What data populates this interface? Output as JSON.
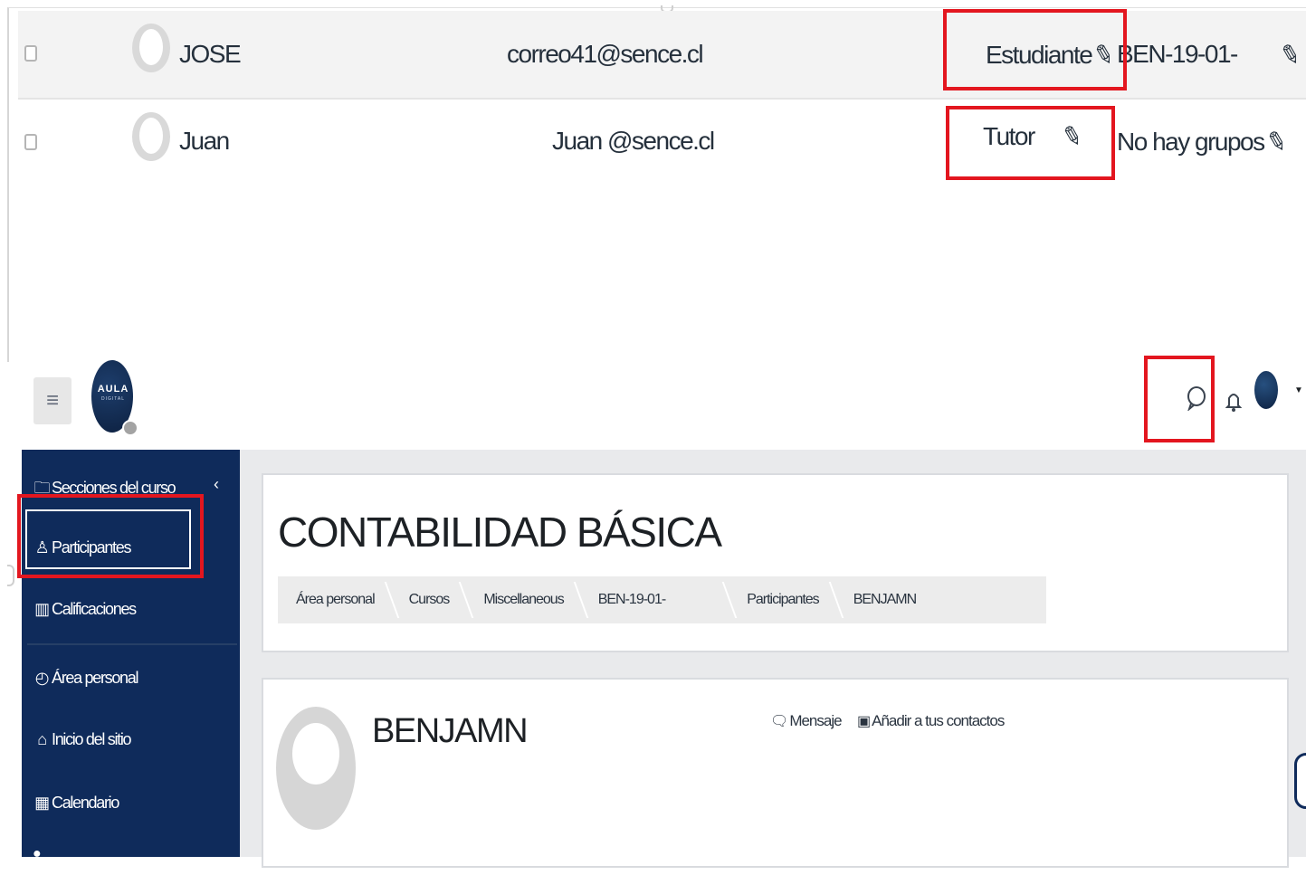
{
  "participants": [
    {
      "name": "JOSE",
      "email": "correo41@sence.cl",
      "role": "Estudiante",
      "group": "BEN-19-01-"
    },
    {
      "name": "Juan",
      "email": "Juan @sence.cl",
      "role": "Tutor",
      "group": "No hay grupos"
    }
  ],
  "header": {
    "logo_text": "AULA",
    "logo_subtext": "DIGITAL",
    "hamburger_glyph": "≡",
    "message_icon": "message-icon",
    "notification_icon": "bell-icon"
  },
  "sidebar": {
    "collapse_glyph": "‹",
    "items": [
      {
        "label": "Secciones del curso",
        "icon": "folder-icon"
      },
      {
        "label": "Participantes",
        "icon": "users-icon"
      },
      {
        "label": "Calificaciones",
        "icon": "grades-icon"
      },
      {
        "label": "Área personal",
        "icon": "dashboard-icon"
      },
      {
        "label": "Inicio del sitio",
        "icon": "home-icon"
      },
      {
        "label": "Calendario",
        "icon": "calendar-icon"
      }
    ]
  },
  "course": {
    "title": "CONTABILIDAD BÁSICA",
    "breadcrumb": [
      "Área personal",
      "Cursos",
      "Miscellaneous",
      "BEN-19-01-",
      "Participantes",
      "BENJAMN"
    ]
  },
  "profile": {
    "name": "BENJAMN",
    "message_label": "Mensaje",
    "add_contact_label": "Añadir a tus contactos"
  },
  "colors": {
    "highlight_red": "#e3161f",
    "sidebar_navy": "#0f2b5b",
    "page_grey": "#e9eaec"
  }
}
